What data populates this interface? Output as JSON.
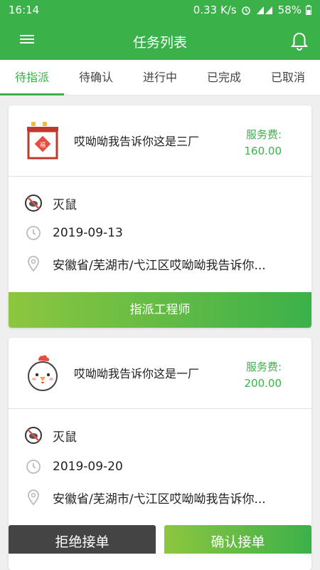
{
  "status": {
    "time": "16:14",
    "net_speed": "0.33 K/s",
    "battery": "58%"
  },
  "header": {
    "title": "任务列表"
  },
  "tabs": [
    {
      "label": "待指派",
      "active": true
    },
    {
      "label": "待确认",
      "active": false
    },
    {
      "label": "进行中",
      "active": false
    },
    {
      "label": "已完成",
      "active": false
    },
    {
      "label": "已取消",
      "active": false
    }
  ],
  "cards": [
    {
      "company": "哎呦呦我告诉你这是三厂",
      "fee_label": "服务费:",
      "fee": "160.00",
      "service": "灭鼠",
      "date": "2019-09-13",
      "address": "安徽省/芜湖市/弋江区哎呦呦我告诉你...",
      "action_label": "指派工程师"
    },
    {
      "company": "哎呦呦我告诉你这是一厂",
      "fee_label": "服务费:",
      "fee": "200.00",
      "service": "灭鼠",
      "date": "2019-09-20",
      "address": "安徽省/芜湖市/弋江区哎呦呦我告诉你...",
      "reject_label": "拒绝接单",
      "confirm_label": "确认接单"
    }
  ],
  "colors": {
    "primary": "#3bb14a",
    "gradient_start": "#8dc63f",
    "reject": "#444444"
  }
}
